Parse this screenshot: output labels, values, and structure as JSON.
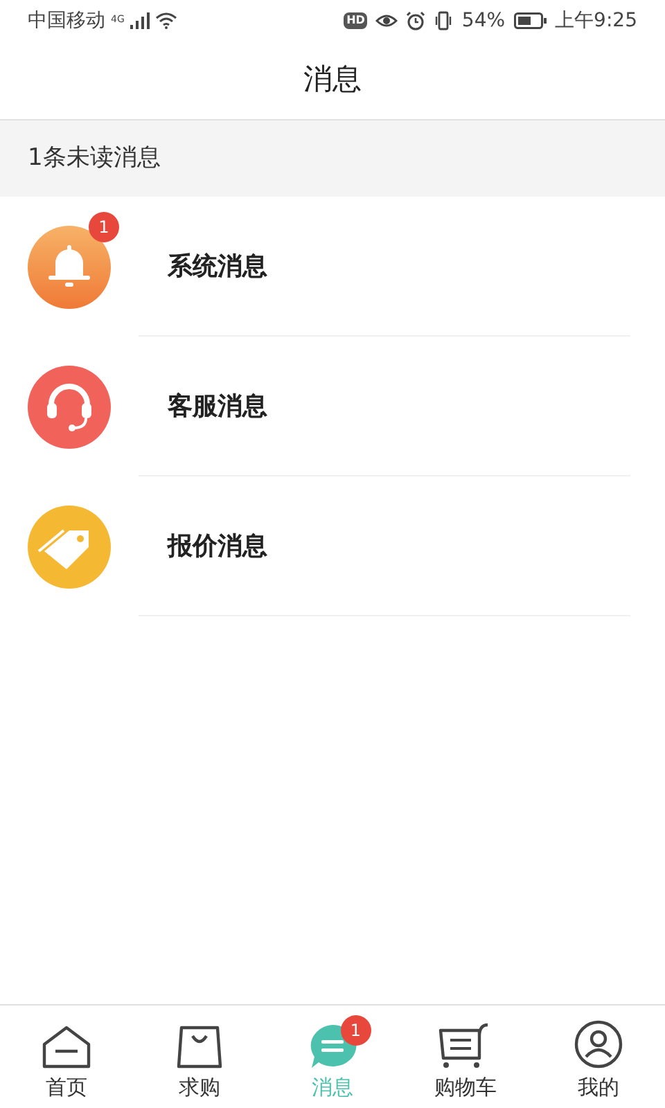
{
  "status_bar": {
    "carrier": "中国移动",
    "network": "4G",
    "hd": "HD",
    "battery_text": "54%",
    "time": "上午9:25"
  },
  "header": {
    "title": "消息"
  },
  "unread_banner": "1条未读消息",
  "messages": [
    {
      "kind": "bell",
      "title": "系统消息",
      "badge": "1"
    },
    {
      "kind": "headset",
      "title": "客服消息"
    },
    {
      "kind": "tag",
      "title": "报价消息"
    }
  ],
  "tabs": [
    {
      "kind": "home",
      "label": "首页",
      "selected": false
    },
    {
      "kind": "bag",
      "label": "求购",
      "selected": false
    },
    {
      "kind": "chat",
      "label": "消息",
      "selected": true,
      "badge": "1"
    },
    {
      "kind": "cart",
      "label": "购物车",
      "selected": false
    },
    {
      "kind": "user",
      "label": "我的",
      "selected": false
    }
  ]
}
